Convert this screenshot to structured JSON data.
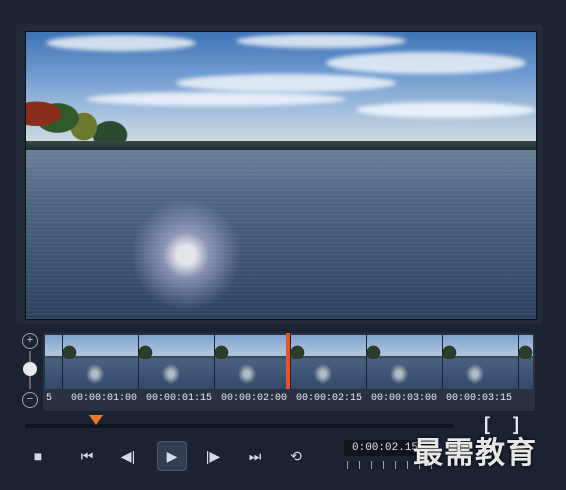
{
  "timeline": {
    "start_label": "5",
    "ticks": [
      "00:00:01:00",
      "00:00:01:15",
      "00:00:02:00",
      "00:00:02:15",
      "00:00:03:00",
      "00:00:03:15"
    ],
    "zoom_in_icon": "+",
    "zoom_out_icon": "−",
    "playhead_color": "#e3562a"
  },
  "transport": {
    "timecode": "0:00:02.15",
    "mark_in": "[",
    "mark_out": "]",
    "icons": {
      "stop": "■",
      "go_start": "⏮",
      "prev_frame": "◀|",
      "play": "▶",
      "next_frame": "|▶",
      "go_end": "⏭",
      "repeat": "⟲"
    },
    "accent": "#f07a25"
  },
  "watermark": "最需教育"
}
